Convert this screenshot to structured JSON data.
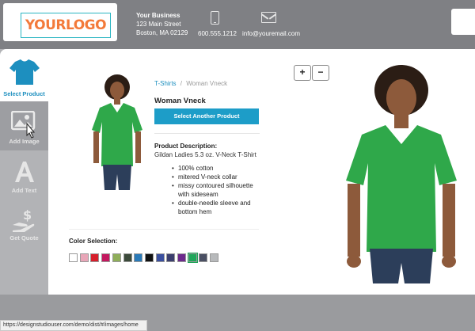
{
  "header": {
    "logo_text": "YOURLOGO",
    "business_name": "Your Business",
    "address_line1": "123 Main Street",
    "address_line2": "Boston, MA 02129",
    "phone": "600.555.1212",
    "email": "info@youremail.com",
    "phone_icon": "phone-icon",
    "email_icon": "envelope-icon"
  },
  "toolbar": {
    "items": [
      {
        "label": "Select Product",
        "icon": "tshirt-icon"
      },
      {
        "label": "Add Image",
        "icon": "image-icon"
      },
      {
        "label": "Add Text",
        "icon": "text-icon"
      },
      {
        "label": "Get Quote",
        "icon": "quote-icon"
      }
    ]
  },
  "product": {
    "breadcrumb_category": "T-Shirts",
    "breadcrumb_separator": "/",
    "breadcrumb_current": "Woman Vneck",
    "name": "Woman Vneck",
    "select_button": "Select Another Product",
    "description_title": "Product Description:",
    "description_subtitle": "Gildan Ladies 5.3 oz. V-Neck T-Shirt",
    "features": [
      "100% cotton",
      "mitered V-neck collar",
      "missy contoured silhouette with sideseam",
      "double-needle sleeve and bottom hem"
    ],
    "color_title": "Color Selection:",
    "colors": [
      "#ffffff",
      "#e8a6b8",
      "#d61f2c",
      "#c3185f",
      "#8fae5a",
      "#3b4a3a",
      "#2a7ab8",
      "#111111",
      "#3a4f9e",
      "#3b3f6e",
      "#6c2a8c",
      "#1fa65a",
      "#4a4f63",
      "#b7b9bb"
    ],
    "selected_color": "#1fa65a"
  },
  "zoom": {
    "in": "+",
    "out": "−"
  },
  "status_url": "https://designstudiouser.com/demo/dist/#/images/home"
}
